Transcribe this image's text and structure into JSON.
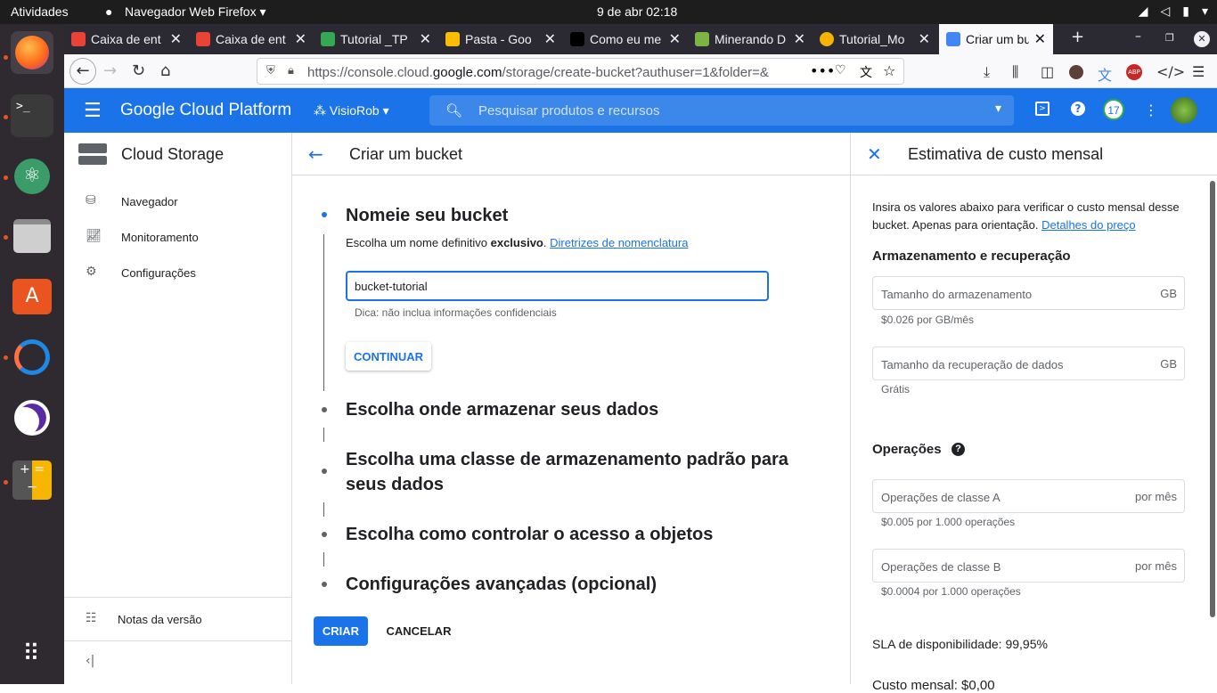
{
  "os": {
    "activities": "Atividades",
    "app_menu": "Navegador Web Firefox ▾",
    "clock": "9 de abr  02:18"
  },
  "browser": {
    "tabs": [
      {
        "label": "Caixa de ent",
        "favicon_color": "#ea4335"
      },
      {
        "label": "Caixa de ent",
        "favicon_color": "#ea4335"
      },
      {
        "label": "Tutorial _TP",
        "favicon_color": "#34a853"
      },
      {
        "label": "Pasta - Goo",
        "favicon_color": "#fbbc04"
      },
      {
        "label": "Como eu me",
        "favicon_color": "#000000"
      },
      {
        "label": "Minerando D",
        "favicon_color": "#7cb342"
      },
      {
        "label": "Tutorial_Mo",
        "favicon_color": "#f4b400"
      },
      {
        "label": "Criar um bu",
        "favicon_color": "#4285f4"
      }
    ],
    "url_prefix": "https://console.cloud.",
    "url_domain": "google.com",
    "url_suffix": "/storage/create-bucket?authuser=1&folder=&"
  },
  "gcp": {
    "brand": "Google Cloud Platform",
    "project": "VisioRob",
    "search_placeholder": "Pesquisar produtos e recursos",
    "notif_count": "17"
  },
  "leftnav": {
    "title": "Cloud Storage",
    "items": [
      {
        "label": "Navegador",
        "icon": "bucket-icon"
      },
      {
        "label": "Monitoramento",
        "icon": "chart-icon"
      },
      {
        "label": "Configurações",
        "icon": "gear-icon"
      }
    ],
    "release_notes": "Notas da versão"
  },
  "main": {
    "title": "Criar um bucket",
    "step1_title": "Nomeie seu bucket",
    "step1_text": "Escolha um nome definitivo",
    "step1_bold": "exclusivo",
    "step1_link": "Diretrizes de nomenclatura",
    "bucket_name": "bucket-tutorial",
    "hint": "Dica: não inclua informações confidenciais",
    "continue_label": "CONTINUAR",
    "step2_title": "Escolha onde armazenar seus dados",
    "step3_title": "Escolha uma classe de armazenamento padrão para seus dados",
    "step4_title": "Escolha como controlar o acesso a objetos",
    "step5_title": "Configurações avançadas (opcional)",
    "create_label": "CRIAR",
    "cancel_label": "CANCELAR"
  },
  "cost_panel": {
    "title": "Estimativa de custo mensal",
    "intro": "Insira os valores abaixo para verificar o custo mensal desse bucket. Apenas para orientação.",
    "intro_link": "Detalhes do preço",
    "storage_section": "Armazenamento e recuperação",
    "storage_size_placeholder": "Tamanho do armazenamento",
    "storage_unit": "GB",
    "storage_price": "$0.026 por GB/mês",
    "retrieval_placeholder": "Tamanho da recuperação de dados",
    "retrieval_unit": "GB",
    "retrieval_price": "Grátis",
    "ops_section": "Operações",
    "class_a_placeholder": "Operações de classe A",
    "class_a_unit": "por mês",
    "class_a_price": "$0.005 por 1.000 operações",
    "class_b_placeholder": "Operações de classe B",
    "class_b_unit": "por mês",
    "class_b_price": "$0.0004 por 1.000 operações",
    "sla": "SLA de disponibilidade: 99,95%",
    "total_partial": "Custo mensal: $0,00"
  }
}
